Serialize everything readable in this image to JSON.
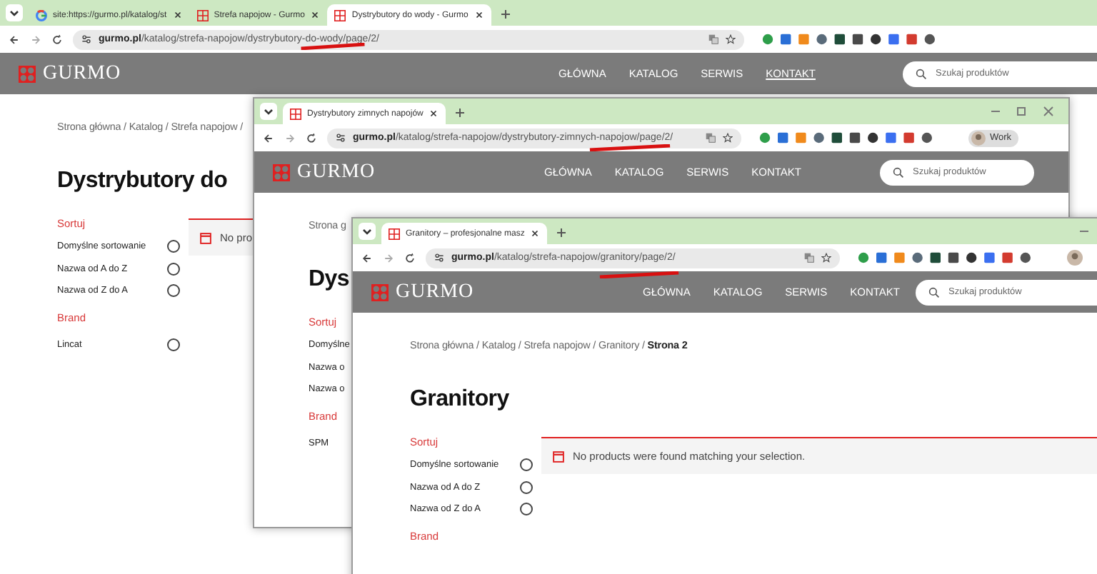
{
  "windows": [
    {
      "tabs": [
        {
          "label": "site:https://gurmo.pl/katalog/st",
          "selected": false,
          "kind": "google"
        },
        {
          "label": "Strefa napojow - Gurmo",
          "selected": false,
          "kind": "gurmo"
        },
        {
          "label": "Dystrybutory do wody - Gurmo",
          "selected": true,
          "kind": "gurmo"
        }
      ],
      "url": {
        "host": "gurmo.pl",
        "path": "/katalog/strefa-napojow/dystrybutory-do-wody/page/2/"
      },
      "logo": "GURMO",
      "nav": [
        {
          "label": "GŁÓWNA",
          "hovered": false
        },
        {
          "label": "KATALOG",
          "hovered": false
        },
        {
          "label": "SERWIS",
          "hovered": false
        },
        {
          "label": "KONTAKT",
          "hovered": true
        }
      ],
      "search": {
        "placeholder": "Szukaj produktów"
      },
      "breadcrumb": "Strona główna / Katalog / Strefa napojow /",
      "title": "Dystrybutory do",
      "sort": {
        "heading": "Sortuj",
        "options": [
          {
            "label": "Domyślne sortowanie",
            "selected": false
          },
          {
            "label": "Nazwa od A do Z",
            "selected": false
          },
          {
            "label": "Nazwa od Z do A",
            "selected": false
          }
        ]
      },
      "brand": {
        "heading": "Brand",
        "items": [
          {
            "label": "Lincat",
            "selected": false
          }
        ]
      },
      "notice": "No pro"
    },
    {
      "tabs": [
        {
          "label": "Dystrybutory zimnych napojów",
          "selected": true,
          "kind": "gurmo"
        }
      ],
      "url": {
        "host": "gurmo.pl",
        "path": "/katalog/strefa-napojow/dystrybutory-zimnych-napojow/page/2/"
      },
      "profile": "Work",
      "logo": "GURMO",
      "nav": [
        {
          "label": "GŁÓWNA",
          "hovered": false
        },
        {
          "label": "KATALOG",
          "hovered": false
        },
        {
          "label": "SERWIS",
          "hovered": false
        },
        {
          "label": "KONTAKT",
          "hovered": false
        }
      ],
      "search": {
        "placeholder": "Szukaj produktów"
      },
      "breadcrumb": "Strona g",
      "title": "Dys",
      "sort": {
        "heading": "Sortuj",
        "options": [
          {
            "label": "Domyślne"
          },
          {
            "label": "Nazwa o"
          },
          {
            "label": "Nazwa o"
          }
        ]
      },
      "brand": {
        "heading": "Brand",
        "items": [
          {
            "label": "SPM"
          }
        ]
      }
    },
    {
      "tabs": [
        {
          "label": "Granitory – profesjonalne masz",
          "selected": true,
          "kind": "gurmo"
        }
      ],
      "url": {
        "host": "gurmo.pl",
        "path": "/katalog/strefa-napojow/granitory/page/2/"
      },
      "logo": "GURMO",
      "nav": [
        {
          "label": "GŁÓWNA",
          "hovered": false
        },
        {
          "label": "KATALOG",
          "hovered": false
        },
        {
          "label": "SERWIS",
          "hovered": false
        },
        {
          "label": "KONTAKT",
          "hovered": false
        }
      ],
      "search": {
        "placeholder": "Szukaj produktów"
      },
      "breadcrumb": "Strona główna / Katalog / Strefa napojow / Granitory / **Strona 2**",
      "title": "Granitory",
      "sort": {
        "heading": "Sortuj",
        "options": [
          {
            "label": "Domyślne sortowanie",
            "selected": false
          },
          {
            "label": "Nazwa od A do Z",
            "selected": false
          },
          {
            "label": "Nazwa od Z do A",
            "selected": false
          }
        ]
      },
      "brand": {
        "heading": "Brand"
      },
      "notice": "No products were found matching your selection."
    }
  ]
}
